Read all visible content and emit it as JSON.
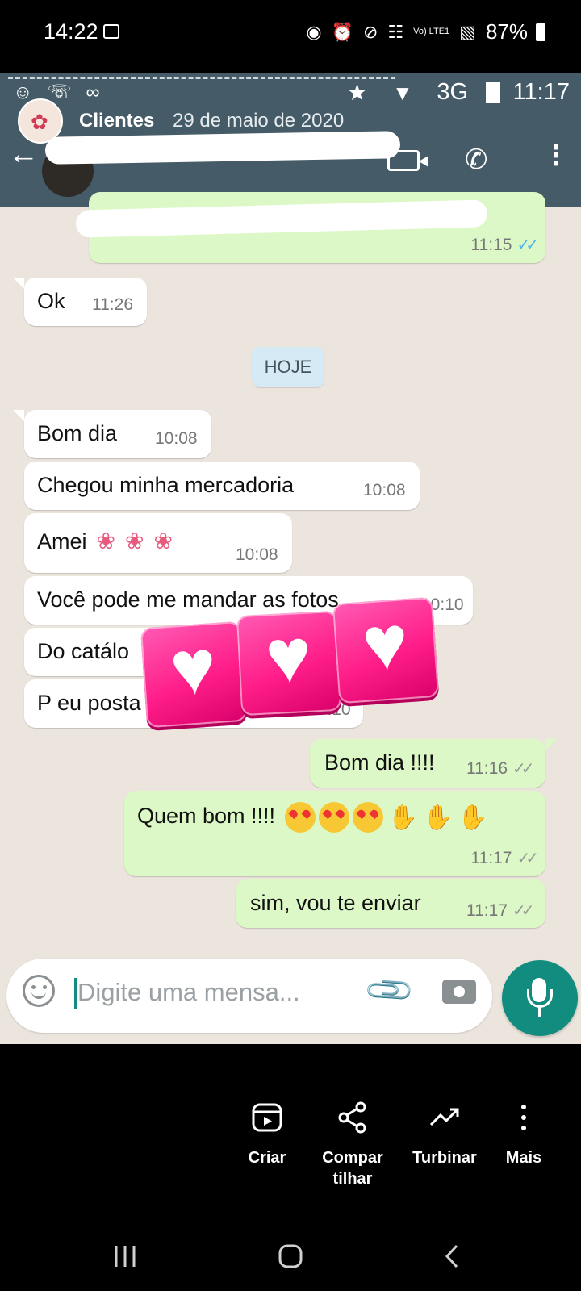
{
  "outer_status": {
    "time": "14:22",
    "battery": "87%",
    "network": "Vo) LTE1"
  },
  "story": {
    "source_name": "Clientes",
    "source_date": "29 de maio de 2020"
  },
  "inner_status": {
    "network": "3G",
    "time": "11:17"
  },
  "chat": {
    "messages": [
      {
        "dir": "out",
        "text": "",
        "time": "11:15",
        "status": "read"
      },
      {
        "dir": "in",
        "text": "Ok",
        "time": "11:26"
      },
      {
        "dir": "chip",
        "text": "HOJE"
      },
      {
        "dir": "in",
        "text": "Bom dia",
        "time": "10:08"
      },
      {
        "dir": "in",
        "text": "Chegou minha mercadoria",
        "time": "10:08"
      },
      {
        "dir": "in",
        "text": "Amei",
        "time": "10:08"
      },
      {
        "dir": "in",
        "text": "Você pode me mandar as fotos",
        "time": "10:10"
      },
      {
        "dir": "in",
        "text": "Do catálo",
        "time": ""
      },
      {
        "dir": "in",
        "text": "P eu posta",
        "time": "10:10"
      },
      {
        "dir": "out",
        "text": "Bom dia !!!!",
        "time": "11:16",
        "status": "delivered"
      },
      {
        "dir": "out",
        "text": "Quem bom !!!!",
        "time": "11:17",
        "status": "delivered"
      },
      {
        "dir": "out",
        "text": "sim, vou te enviar",
        "time": "11:17",
        "status": "delivered"
      }
    ]
  },
  "input": {
    "placeholder": "Digite uma mensa..."
  },
  "actions": [
    {
      "label": "Criar",
      "icon": "reel-icon"
    },
    {
      "label": "Compar tilhar",
      "icon": "share-icon"
    },
    {
      "label": "Turbinar",
      "icon": "trend-icon"
    },
    {
      "label": "Mais",
      "icon": "more-vert-icon"
    }
  ],
  "colors": {
    "header": "#455b67",
    "outgoing": "#dcf8c6",
    "incoming": "#ffffff",
    "wallpaper": "#ece5dd",
    "mic": "#128c7e",
    "hearts": "#ff1e8a"
  }
}
